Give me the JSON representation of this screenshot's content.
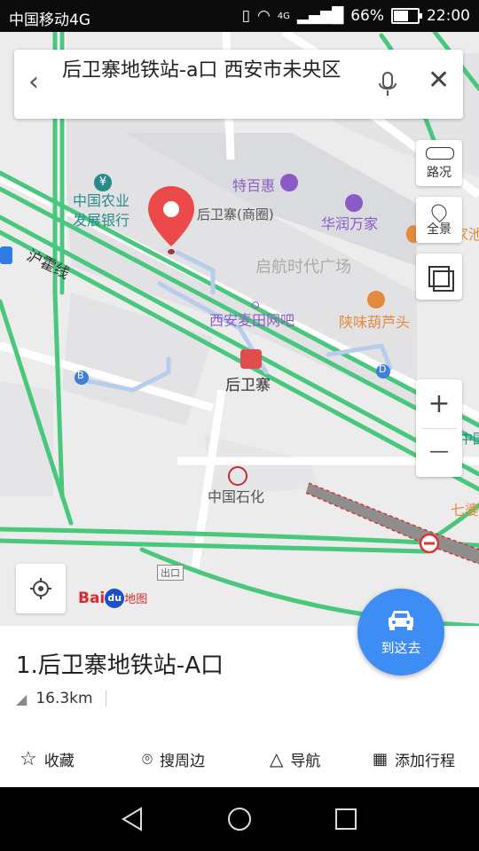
{
  "status_bar": {
    "carrier": "中国移动4G",
    "network": "4G",
    "battery": "66%",
    "battery_level": 0.66,
    "time": "22:00"
  },
  "search": {
    "title": "后卫寨地铁站-a口 西安市未央区"
  },
  "side_buttons": {
    "traffic": "路况",
    "panorama": "全景",
    "zoom_in": "+",
    "zoom_out": "—"
  },
  "map_labels": {
    "bank": "中国农业\n发展银行",
    "supermarket": "特百惠",
    "mall": "后卫寨(商圈)",
    "store": "华润万家",
    "partial_right": "家池",
    "line_name": "沪霍线",
    "plaza": "启航时代广场",
    "internet_cafe": "西安麦田网吧",
    "restaurant": "陕味葫芦头",
    "station": "后卫寨",
    "exit_b": "B",
    "exit_d": "D",
    "gas_station": "中国石化",
    "edge_right": "中国",
    "qipo": "七婆",
    "exit": "出口"
  },
  "logo": {
    "brand": "Bai",
    "paw": "du",
    "suffix": "地图"
  },
  "result": {
    "title": "1.后卫寨地铁站-A口",
    "distance": "16.3km"
  },
  "actions": {
    "favorite": "收藏",
    "search_nearby": "搜周边",
    "navigate": "导航",
    "add_trip": "添加行程"
  },
  "go_button": {
    "label": "到这去"
  },
  "colors": {
    "road_green": "#49c77d",
    "accent_blue": "#3e8df5",
    "pin_red": "#ec4a4a",
    "poi_orange": "#e38b3b",
    "poi_purple": "#8b5bc5",
    "poi_teal": "#2a8a8a"
  }
}
